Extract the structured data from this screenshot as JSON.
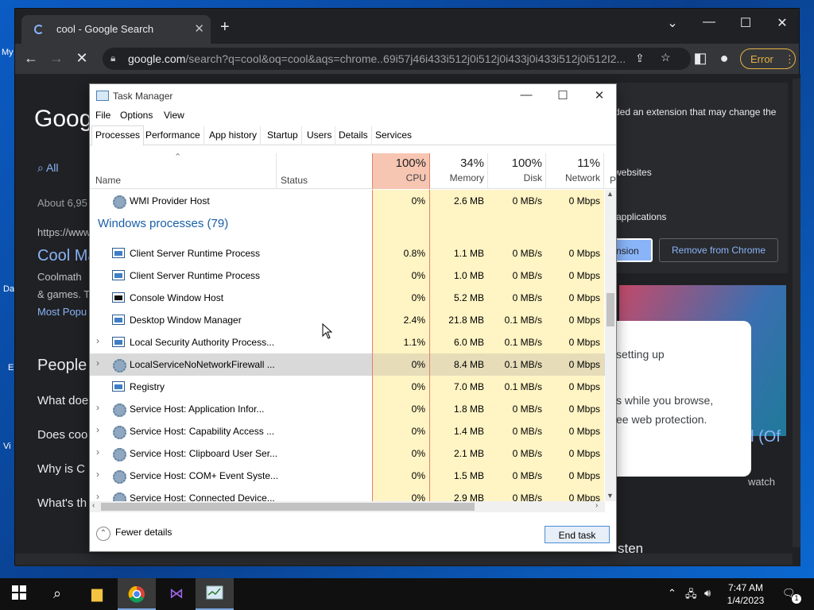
{
  "desktop": {
    "labels": [
      "My",
      "Da",
      "E",
      "Vi"
    ]
  },
  "chrome": {
    "tab_title": "cool - Google Search",
    "url_host": "google.com",
    "url_path": "/search?q=cool&oq=cool&aqs=chrome..69i57j46i433i512j0i512j0i433j0i433i512j0i512I2...",
    "error_label": "Error",
    "page": {
      "logo": "Goog",
      "all_tab": "All",
      "result_count": "About 6,95",
      "result_url": "https://www",
      "result_title": "Cool Ma",
      "result_snippet_1": "Coolmath",
      "result_snippet_2": "& games. T",
      "result_snippet_3": "Most Popu",
      "people_heading": "People",
      "q1": "What doe",
      "q2": "Does coo",
      "q3": "Why is C",
      "q4": "What's th",
      "listen": "sten",
      "kp_title": "ol (Of",
      "kp_watch": "watch"
    },
    "ext_popup": {
      "line1": "ded an extension that may change the",
      "line2": "websites",
      "line3": "applications",
      "btn_keep": "nsion",
      "btn_remove": "Remove from Chrome"
    },
    "safe_popup": {
      "line1": "setting up",
      "line2": "s while you browse,",
      "line3": "ee web protection."
    }
  },
  "taskmanager": {
    "title": "Task Manager",
    "menu": [
      "File",
      "Options",
      "View"
    ],
    "tabs": [
      "Processes",
      "Performance",
      "App history",
      "Startup",
      "Users",
      "Details",
      "Services"
    ],
    "headers": {
      "name": "Name",
      "status": "Status",
      "cpu_pct": "100%",
      "cpu": "CPU",
      "mem_pct": "34%",
      "mem": "Memory",
      "disk_pct": "100%",
      "disk": "Disk",
      "net_pct": "11%",
      "net": "Network",
      "power": "P"
    },
    "group_label": "Windows processes (79)",
    "rows": [
      {
        "name": "WMI Provider Host",
        "cpu": "0%",
        "mem": "2.6 MB",
        "disk": "0 MB/s",
        "net": "0 Mbps"
      },
      {
        "name": "Client Server Runtime Process",
        "cpu": "0.8%",
        "mem": "1.1 MB",
        "disk": "0 MB/s",
        "net": "0 Mbps"
      },
      {
        "name": "Client Server Runtime Process",
        "cpu": "0%",
        "mem": "1.0 MB",
        "disk": "0 MB/s",
        "net": "0 Mbps"
      },
      {
        "name": "Console Window Host",
        "cpu": "0%",
        "mem": "5.2 MB",
        "disk": "0 MB/s",
        "net": "0 Mbps"
      },
      {
        "name": "Desktop Window Manager",
        "cpu": "2.4%",
        "mem": "21.8 MB",
        "disk": "0.1 MB/s",
        "net": "0 Mbps"
      },
      {
        "name": "Local Security Authority Process...",
        "cpu": "1.1%",
        "mem": "6.0 MB",
        "disk": "0.1 MB/s",
        "net": "0 Mbps"
      },
      {
        "name": "LocalServiceNoNetworkFirewall ...",
        "cpu": "0%",
        "mem": "8.4 MB",
        "disk": "0.1 MB/s",
        "net": "0 Mbps"
      },
      {
        "name": "Registry",
        "cpu": "0%",
        "mem": "7.0 MB",
        "disk": "0.1 MB/s",
        "net": "0 Mbps"
      },
      {
        "name": "Service Host: Application Infor...",
        "cpu": "0%",
        "mem": "1.8 MB",
        "disk": "0 MB/s",
        "net": "0 Mbps"
      },
      {
        "name": "Service Host: Capability Access ...",
        "cpu": "0%",
        "mem": "1.4 MB",
        "disk": "0 MB/s",
        "net": "0 Mbps"
      },
      {
        "name": "Service Host: Clipboard User Ser...",
        "cpu": "0%",
        "mem": "2.1 MB",
        "disk": "0 MB/s",
        "net": "0 Mbps"
      },
      {
        "name": "Service Host: COM+ Event Syste...",
        "cpu": "0%",
        "mem": "1.5 MB",
        "disk": "0 MB/s",
        "net": "0 Mbps"
      },
      {
        "name": "Service Host: Connected Device...",
        "cpu": "0%",
        "mem": "2.9 MB",
        "disk": "0 MB/s",
        "net": "0 Mbps"
      }
    ],
    "fewer_details": "Fewer details",
    "end_task": "End task"
  },
  "taskbar": {
    "time": "7:47 AM",
    "date": "1/4/2023",
    "notification_count": "1"
  }
}
